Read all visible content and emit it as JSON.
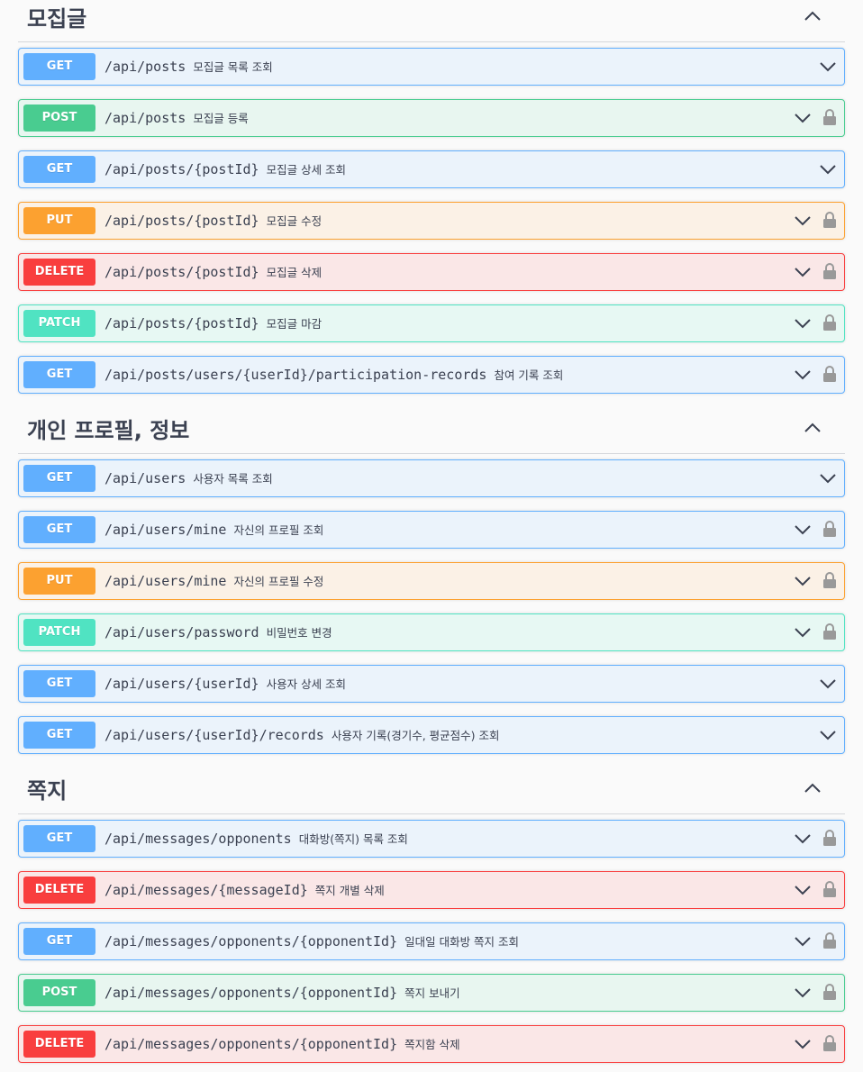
{
  "icons": {
    "expand": "chevron-down-icon",
    "collapse": "chevron-up-icon",
    "auth": "lock-icon"
  },
  "colors": {
    "get": "#61affe",
    "post": "#49cc90",
    "put": "#fca130",
    "delete": "#f93e3e",
    "patch": "#50e3c2"
  },
  "sections": [
    {
      "title": "모집글",
      "operations": [
        {
          "method": "GET",
          "path": "/api/posts",
          "summary": "모집글 목록 조회",
          "locked": false
        },
        {
          "method": "POST",
          "path": "/api/posts",
          "summary": "모집글 등록",
          "locked": true
        },
        {
          "method": "GET",
          "path": "/api/posts/{postId}",
          "summary": "모집글 상세 조회",
          "locked": false
        },
        {
          "method": "PUT",
          "path": "/api/posts/{postId}",
          "summary": "모집글 수정",
          "locked": true
        },
        {
          "method": "DELETE",
          "path": "/api/posts/{postId}",
          "summary": "모집글 삭제",
          "locked": true
        },
        {
          "method": "PATCH",
          "path": "/api/posts/{postId}",
          "summary": "모집글 마감",
          "locked": true
        },
        {
          "method": "GET",
          "path": "/api/posts/users/{userId}/participation-records",
          "summary": "참여 기록 조회",
          "locked": true
        }
      ]
    },
    {
      "title": "개인 프로필, 정보",
      "operations": [
        {
          "method": "GET",
          "path": "/api/users",
          "summary": "사용자 목록 조회",
          "locked": false
        },
        {
          "method": "GET",
          "path": "/api/users/mine",
          "summary": "자신의 프로필 조회",
          "locked": true
        },
        {
          "method": "PUT",
          "path": "/api/users/mine",
          "summary": "자신의 프로필 수정",
          "locked": true
        },
        {
          "method": "PATCH",
          "path": "/api/users/password",
          "summary": "비밀번호 변경",
          "locked": true
        },
        {
          "method": "GET",
          "path": "/api/users/{userId}",
          "summary": "사용자 상세 조회",
          "locked": false
        },
        {
          "method": "GET",
          "path": "/api/users/{userId}/records",
          "summary": "사용자 기록(경기수, 평균점수) 조회",
          "locked": false
        }
      ]
    },
    {
      "title": "쪽지",
      "operations": [
        {
          "method": "GET",
          "path": "/api/messages/opponents",
          "summary": "대화방(쪽지) 목록 조회",
          "locked": true
        },
        {
          "method": "DELETE",
          "path": "/api/messages/{messageId}",
          "summary": "쪽지 개별 삭제",
          "locked": true
        },
        {
          "method": "GET",
          "path": "/api/messages/opponents/{opponentId}",
          "summary": "일대일 대화방 쪽지 조회",
          "locked": true
        },
        {
          "method": "POST",
          "path": "/api/messages/opponents/{opponentId}",
          "summary": "쪽지 보내기",
          "locked": true
        },
        {
          "method": "DELETE",
          "path": "/api/messages/opponents/{opponentId}",
          "summary": "쪽지함 삭제",
          "locked": true
        }
      ]
    }
  ]
}
